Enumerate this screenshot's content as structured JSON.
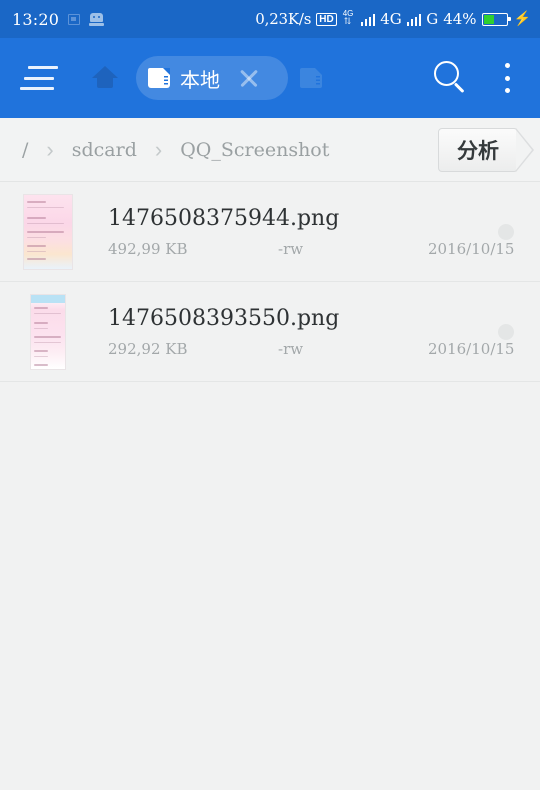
{
  "statusbar": {
    "time": "13:20",
    "cast_icon": "cast-icon",
    "robot_icon": "android-robot-icon",
    "network_speed": "0,23K/s",
    "hd_label": "HD",
    "data_label": "4G",
    "data_arrows": "⇅",
    "sim1_network": "4G",
    "sim2_network": "G",
    "battery_percent": "44%",
    "charging_bolt": "⚡"
  },
  "toolbar": {
    "menu_icon": "hamburger-menu-icon",
    "home_icon": "home-icon",
    "tab": {
      "storage_icon": "sdcard-icon",
      "label": "本地",
      "close_icon": "close-icon"
    },
    "tab_secondary_icon": "sdcard-icon",
    "search_icon": "search-icon",
    "overflow_icon": "more-vertical-icon"
  },
  "breadcrumb": {
    "items": [
      {
        "label": "/"
      },
      {
        "label": "sdcard"
      },
      {
        "label": "QQ_Screenshot"
      }
    ],
    "separator": "›",
    "analyze_label": "分析"
  },
  "files": [
    {
      "name": "1476508375944.png",
      "size": "492,99 KB",
      "permissions": "-rw",
      "date": "2016/10/15",
      "thumbnail": "pink-screenshot-thumbnail",
      "selected_icon": "selection-dot"
    },
    {
      "name": "1476508393550.png",
      "size": "292,92 KB",
      "permissions": "-rw",
      "date": "2016/10/15",
      "thumbnail": "pink-blue-screenshot-thumbnail",
      "selected_icon": "selection-dot"
    }
  ],
  "colors": {
    "statusbar": "#1a67c6",
    "toolbar": "#2073dc",
    "background": "#f1f2f2",
    "battery_fill": "#2fd02f",
    "divider": "#e4e6e6"
  }
}
